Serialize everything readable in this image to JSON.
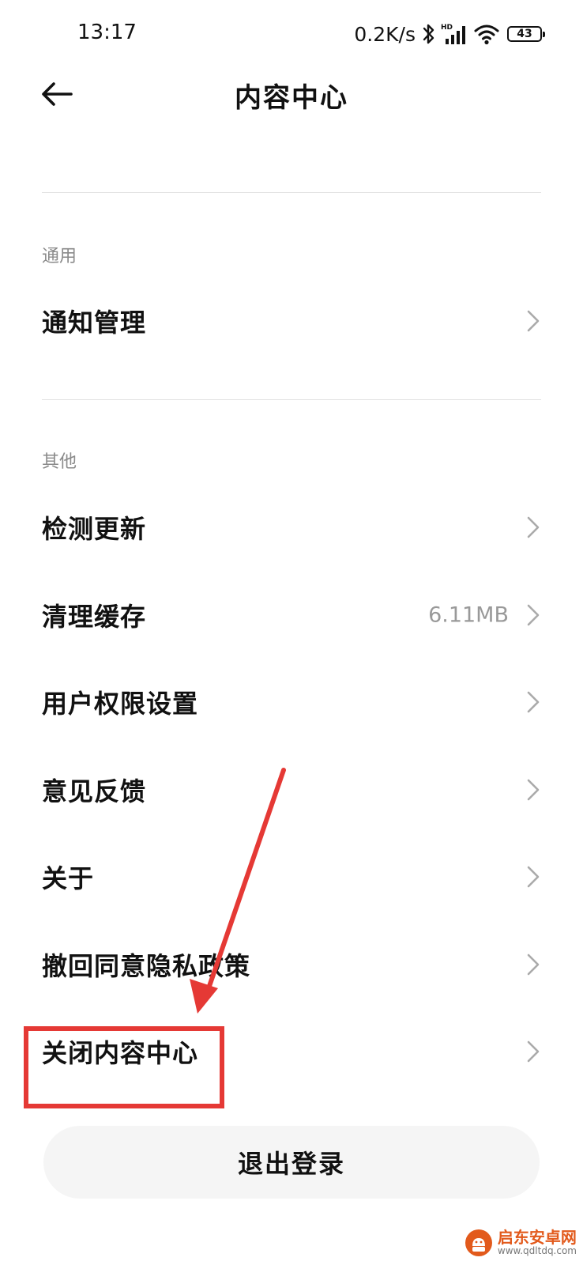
{
  "status_bar": {
    "time": "13:17",
    "net_speed": "0.2K/s",
    "battery": "43"
  },
  "header": {
    "title": "内容中心"
  },
  "sections": [
    {
      "label": "通用",
      "items": [
        {
          "label": "通知管理",
          "value": ""
        }
      ]
    },
    {
      "label": "其他",
      "items": [
        {
          "label": "检测更新",
          "value": ""
        },
        {
          "label": "清理缓存",
          "value": "6.11MB"
        },
        {
          "label": "用户权限设置",
          "value": ""
        },
        {
          "label": "意见反馈",
          "value": ""
        },
        {
          "label": "关于",
          "value": ""
        },
        {
          "label": "撤回同意隐私政策",
          "value": ""
        },
        {
          "label": "关闭内容中心",
          "value": ""
        }
      ]
    }
  ],
  "logout_button": {
    "label": "退出登录"
  },
  "annotation": {
    "color": "#e53935"
  },
  "watermark": {
    "name": "启东安卓网",
    "url": "www.qdltdq.com",
    "color": "#e25a1c"
  }
}
